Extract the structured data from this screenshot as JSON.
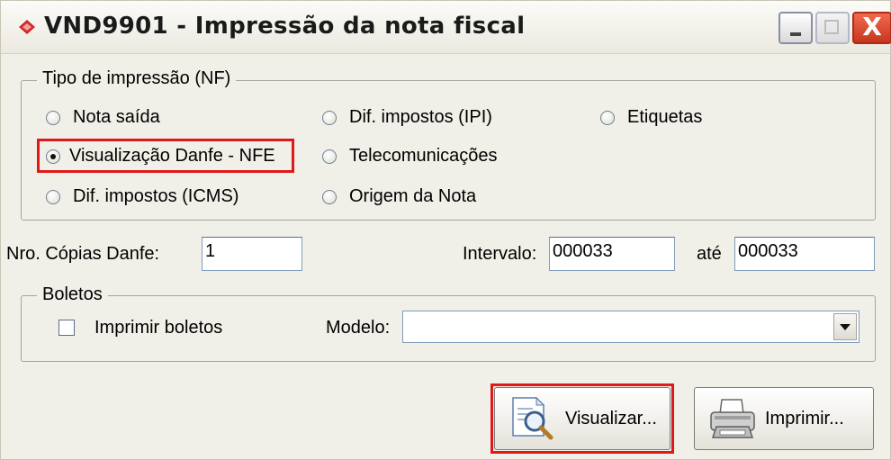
{
  "window": {
    "title": "VND9901 - Impressão da nota fiscal",
    "buttons": {
      "minimize": "_",
      "maximize": "□",
      "close": "X"
    }
  },
  "tipo_impressao": {
    "legend": "Tipo de impressão (NF)",
    "options": [
      {
        "label": "Nota saída",
        "selected": false
      },
      {
        "label": "Dif. impostos (IPI)",
        "selected": false
      },
      {
        "label": "Etiquetas",
        "selected": false
      },
      {
        "label": "Visualização Danfe - NFE",
        "selected": true
      },
      {
        "label": "Telecomunicações",
        "selected": false
      },
      {
        "label": "Dif. impostos (ICMS)",
        "selected": false
      },
      {
        "label": "Origem da Nota",
        "selected": false
      }
    ]
  },
  "copias": {
    "label": "Nro. Cópias Danfe:",
    "value": "1"
  },
  "intervalo": {
    "label": "Intervalo:",
    "from": "000033",
    "ate_label": "até",
    "to": "000033"
  },
  "boletos": {
    "legend": "Boletos",
    "imprimir_label": "Imprimir boletos",
    "imprimir_checked": false,
    "modelo_label": "Modelo:",
    "modelo_value": ""
  },
  "actions": {
    "visualizar": "Visualizar...",
    "imprimir": "Imprimir..."
  },
  "colors": {
    "highlight": "#e01818",
    "window_bg": "#f0efe8"
  }
}
